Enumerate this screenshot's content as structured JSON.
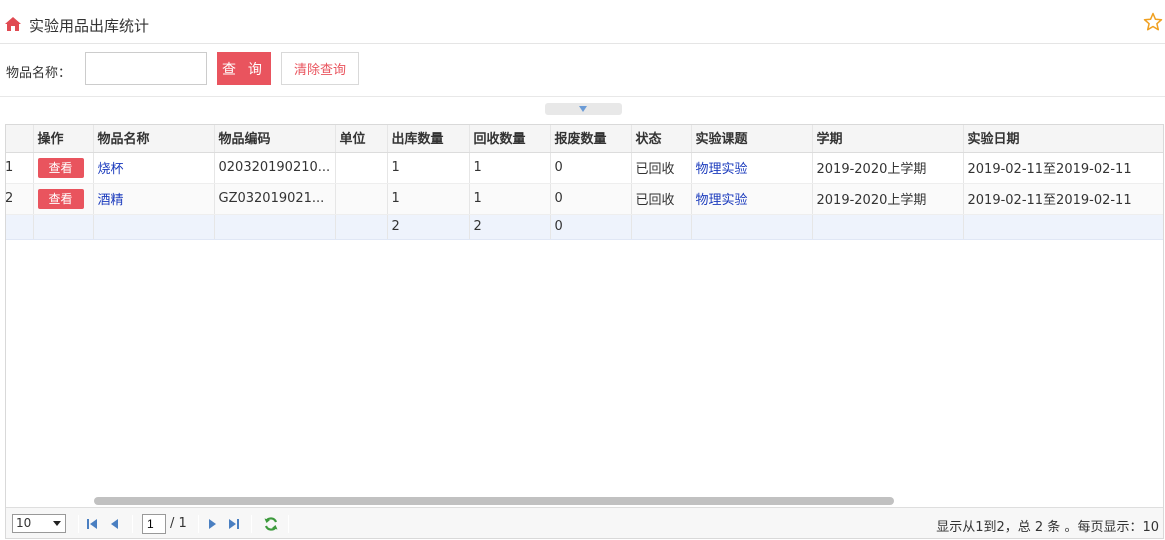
{
  "header": {
    "title": "实验用品出库统计",
    "icons": {
      "home": "home-icon",
      "favorite": "star-icon"
    }
  },
  "search": {
    "label": "物品名称：",
    "input_value": "",
    "query_label": "查 询",
    "clear_label": "清除查询"
  },
  "grid": {
    "columns": [
      "",
      "操作",
      "物品名称",
      "物品编码",
      "单位",
      "出库数量",
      "回收数量",
      "报废数量",
      "状态",
      "实验课题",
      "学期",
      "实验日期"
    ],
    "rows": [
      {
        "num": "1",
        "action": "查看",
        "name": "烧杯",
        "code": "020320190210...",
        "unit": "",
        "out_qty": "1",
        "recycle_qty": "1",
        "scrap_qty": "0",
        "status": "已回收",
        "topic": "物理实验",
        "term": "2019-2020上学期",
        "date": "2019-02-11至2019-02-11"
      },
      {
        "num": "2",
        "action": "查看",
        "name": "酒精",
        "code": "GZ032019021...",
        "unit": "",
        "out_qty": "1",
        "recycle_qty": "1",
        "scrap_qty": "0",
        "status": "已回收",
        "topic": "物理实验",
        "term": "2019-2020上学期",
        "date": "2019-02-11至2019-02-11"
      }
    ],
    "footer": {
      "out_total": "2",
      "recycle_total": "2",
      "scrap_total": "0"
    }
  },
  "pager": {
    "page_size": "10",
    "page_size_options": [
      "10"
    ],
    "current_page": "1",
    "total_pages_text": "/ 1",
    "info": "显示从1到2，总 2 条 。每页显示：10",
    "icons": [
      "first-page-icon",
      "prev-page-icon",
      "next-page-icon",
      "last-page-icon",
      "refresh-icon"
    ]
  },
  "colors": {
    "accent": "#e9545e",
    "link": "#1b3bbd",
    "footer_row": "#eef3fc",
    "star": "#f0a020"
  }
}
